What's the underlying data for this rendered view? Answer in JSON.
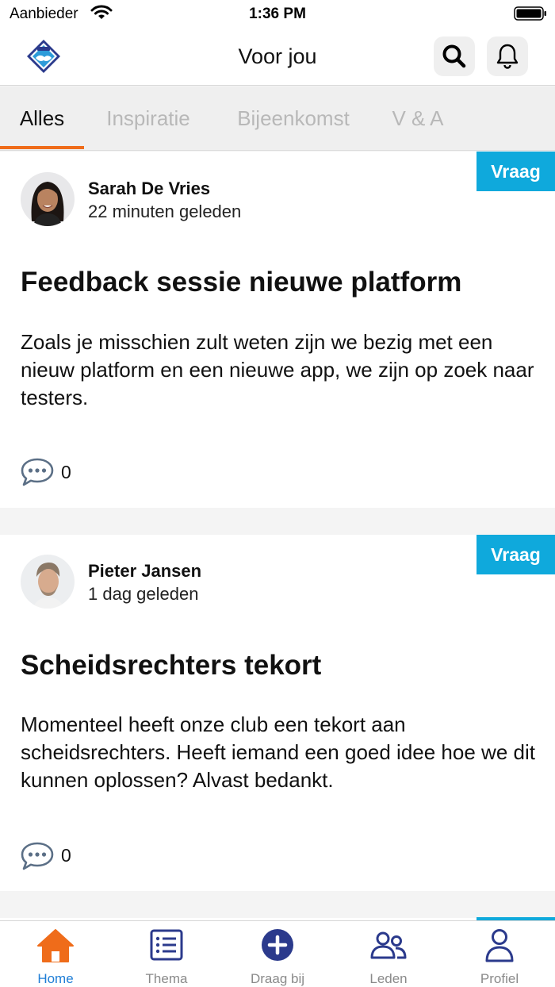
{
  "status_bar": {
    "carrier": "Aanbieder",
    "time": "1:36 PM"
  },
  "header": {
    "title": "Voor jou",
    "logo_icon": "club-shield-logo-icon",
    "search_icon": "search-icon",
    "notifications_icon": "bell-icon"
  },
  "tabs": [
    {
      "label": "Alles",
      "active": true
    },
    {
      "label": "Inspiratie",
      "active": false
    },
    {
      "label": "Bijeenkomst",
      "active": false
    },
    {
      "label": "V & A",
      "active": false
    }
  ],
  "posts": [
    {
      "badge": "Vraag",
      "author": "Sarah De Vries",
      "time": "22 minuten geleden",
      "title": "Feedback sessie nieuwe platform",
      "body": "Zoals je misschien zult weten zijn we bezig met een nieuw platform en een nieuwe app, we zijn op zoek naar testers.",
      "comments": "0"
    },
    {
      "badge": "Vraag",
      "author": "Pieter Jansen",
      "time": "1 dag geleden",
      "title": "Scheidsrechters tekort",
      "body": "Momenteel heeft onze club een tekort aan scheidsrechters. Heeft iemand een goed idee hoe we dit kunnen oplossen? Alvast bedankt.",
      "comments": "0"
    }
  ],
  "bottom_nav": [
    {
      "label": "Home",
      "icon": "home-icon",
      "active": true
    },
    {
      "label": "Thema",
      "icon": "list-icon",
      "active": false
    },
    {
      "label": "Draag bij",
      "icon": "plus-circle-icon",
      "active": false
    },
    {
      "label": "Leden",
      "icon": "members-icon",
      "active": false
    },
    {
      "label": "Profiel",
      "icon": "profile-icon",
      "active": false
    }
  ],
  "colors": {
    "accent_orange": "#ef6c1a",
    "badge_blue": "#0fa9dc",
    "nav_active_blue": "#1f7ed6",
    "brand_navy": "#2b3a8c"
  }
}
